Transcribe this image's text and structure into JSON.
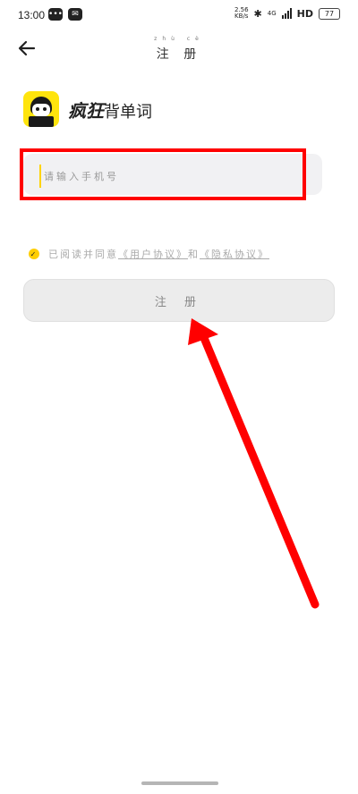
{
  "status_bar": {
    "time": "13:00",
    "left_icons": [
      "chat-icon",
      "message-icon"
    ],
    "net_speed_top": "2.56",
    "net_speed_bottom": "KB/s",
    "network": "4G",
    "hd": "HD",
    "battery": "77"
  },
  "nav": {
    "back_icon": "arrow-left-icon",
    "title": "注 册",
    "title_pinyin": "zhù cè"
  },
  "brand": {
    "name_bold": "疯狂",
    "name_rest": "背单词"
  },
  "phone": {
    "placeholder": "请输入手机号"
  },
  "agreement": {
    "prefix": "已阅读并同意",
    "user_agreement": "《用户协议》",
    "and": "和",
    "privacy_agreement": "《隐私协议》"
  },
  "register_button": {
    "label": "注 册"
  },
  "colors": {
    "accent_yellow": "#ffd400",
    "annotation_red": "#ff0000"
  }
}
